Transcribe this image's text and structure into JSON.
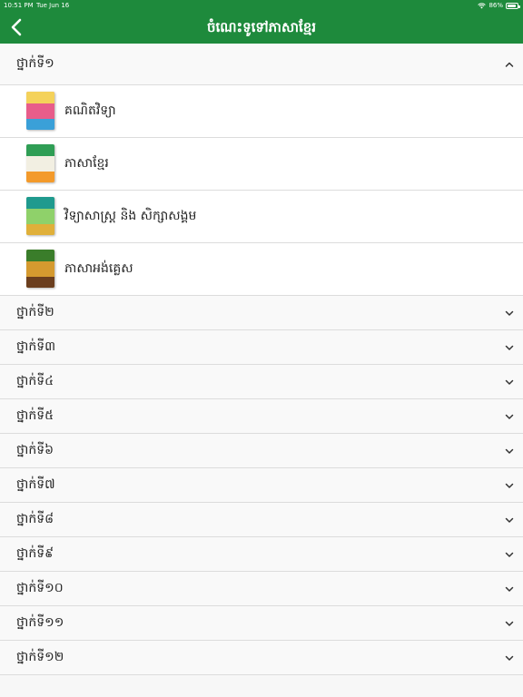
{
  "status_bar": {
    "time": "10:51 PM",
    "date": "Tue Jun 16",
    "battery": "86%",
    "battery_level": 0.86
  },
  "header": {
    "title": "ចំណេះទូទៅភាសាខ្មែរ",
    "back_icon": "chevron-left-icon"
  },
  "colors": {
    "header": "#1e8a3c",
    "divider": "#dcdcdc"
  },
  "grades": [
    {
      "label": "ថ្នាក់ទី១",
      "expanded": true,
      "books": [
        {
          "title": "គណិតវិទ្យា",
          "cover": {
            "top": "#f4d25a",
            "mid": "#e85d8a",
            "bottom": "#3aa0d8"
          }
        },
        {
          "title": "ភាសាខ្មែរ",
          "cover": {
            "top": "#2f9e55",
            "mid": "#f2efe2",
            "bottom": "#f39a2b"
          }
        },
        {
          "title": "វិទ្យាសាស្ត្រ និង សិក្សាសង្គម",
          "cover": {
            "top": "#1f9a8e",
            "mid": "#8fd16a",
            "bottom": "#e0b03a"
          }
        },
        {
          "title": "ភាសាអង់គ្លេស",
          "cover": {
            "top": "#3a7d2a",
            "mid": "#d59a2f",
            "bottom": "#6b3e1e"
          }
        }
      ]
    },
    {
      "label": "ថ្នាក់ទី២",
      "expanded": false
    },
    {
      "label": "ថ្នាក់ទី៣",
      "expanded": false
    },
    {
      "label": "ថ្នាក់ទី៤",
      "expanded": false
    },
    {
      "label": "ថ្នាក់ទី៥",
      "expanded": false
    },
    {
      "label": "ថ្នាក់ទី៦",
      "expanded": false
    },
    {
      "label": "ថ្នាក់ទី៧",
      "expanded": false
    },
    {
      "label": "ថ្នាក់ទី៨",
      "expanded": false
    },
    {
      "label": "ថ្នាក់ទី៩",
      "expanded": false
    },
    {
      "label": "ថ្នាក់ទី១០",
      "expanded": false
    },
    {
      "label": "ថ្នាក់ទី១១",
      "expanded": false
    },
    {
      "label": "ថ្នាក់ទី១២",
      "expanded": false
    }
  ]
}
